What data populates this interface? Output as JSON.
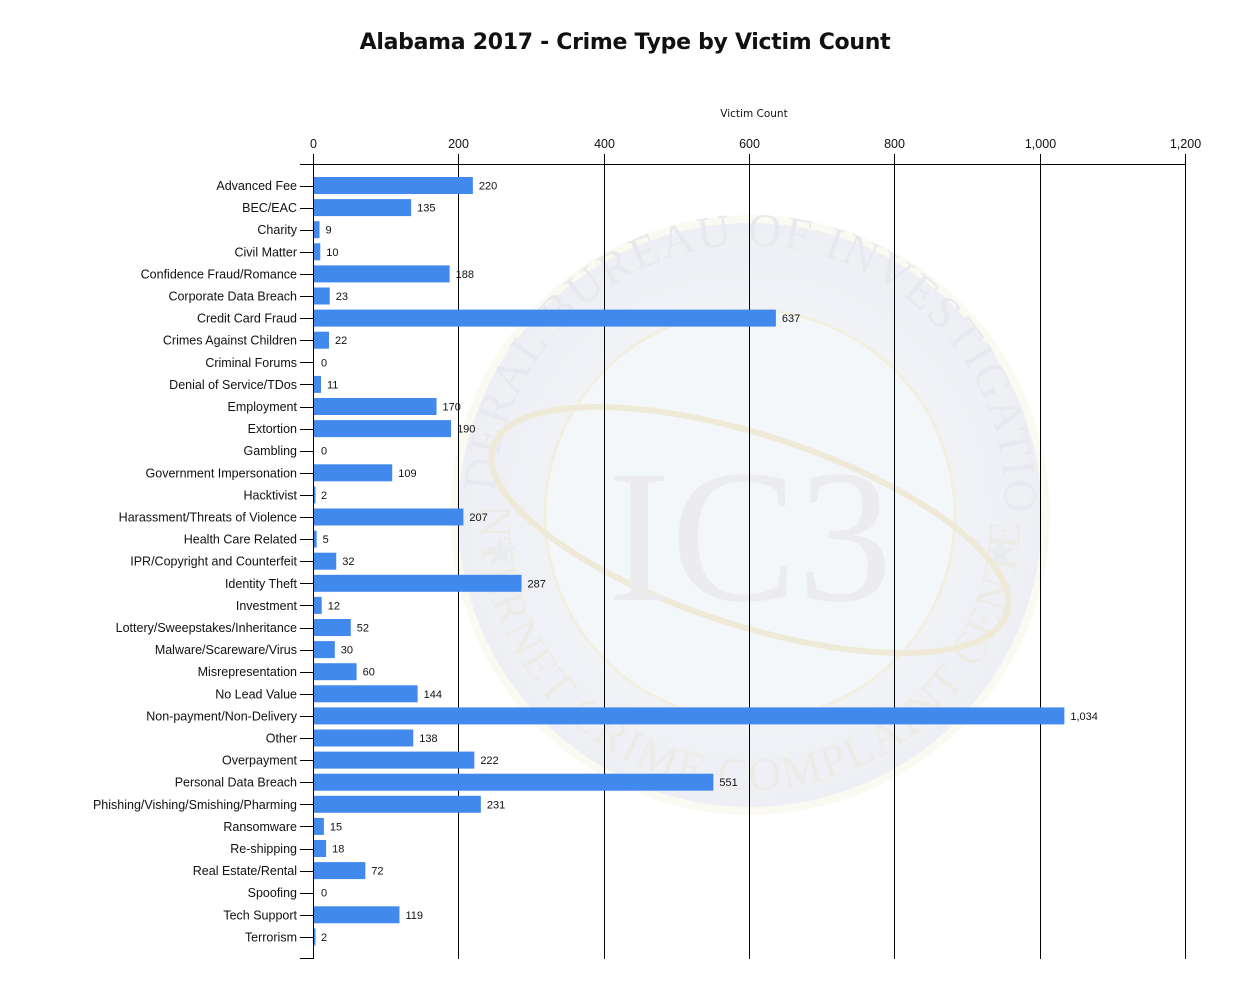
{
  "chart_data": {
    "type": "bar",
    "orientation": "horizontal",
    "title": "Alabama 2017 - Crime Type by Victim Count",
    "xlabel": "Victim Count",
    "ylabel": "",
    "xlim": [
      0,
      1200
    ],
    "x_ticks": [
      0,
      200,
      400,
      600,
      800,
      1000,
      1200
    ],
    "x_tick_labels": [
      "0",
      "200",
      "400",
      "600",
      "800",
      "1,000",
      "1,200"
    ],
    "x_axis_position": "top",
    "grid": "vertical",
    "legend": "none",
    "bar_color": "#4189EC",
    "watermark": "FEDERAL BUREAU OF INVESTIGATION - INTERNET CRIME COMPLAINT CENTER (IC3) seal",
    "categories": [
      "Advanced Fee",
      "BEC/EAC",
      "Charity",
      "Civil Matter",
      "Confidence Fraud/Romance",
      "Corporate Data Breach",
      "Credit Card Fraud",
      "Crimes Against Children",
      "Criminal Forums",
      "Denial of Service/TDos",
      "Employment",
      "Extortion",
      "Gambling",
      "Government Impersonation",
      "Hacktivist",
      "Harassment/Threats of Violence",
      "Health Care Related",
      "IPR/Copyright and Counterfeit",
      "Identity Theft",
      "Investment",
      "Lottery/Sweepstakes/Inheritance",
      "Malware/Scareware/Virus",
      "Misrepresentation",
      "No Lead Value",
      "Non-payment/Non-Delivery",
      "Other",
      "Overpayment",
      "Personal Data Breach",
      "Phishing/Vishing/Smishing/Pharming",
      "Ransomware",
      "Re-shipping",
      "Real Estate/Rental",
      "Spoofing",
      "Tech Support",
      "Terrorism"
    ],
    "values": [
      220,
      135,
      9,
      10,
      188,
      23,
      637,
      22,
      0,
      11,
      170,
      190,
      0,
      109,
      2,
      207,
      5,
      32,
      287,
      12,
      52,
      30,
      60,
      144,
      1034,
      138,
      222,
      551,
      231,
      15,
      18,
      72,
      0,
      119,
      2
    ],
    "value_labels": [
      "220",
      "135",
      "9",
      "10",
      "188",
      "23",
      "637",
      "22",
      "0",
      "11",
      "170",
      "190",
      "0",
      "109",
      "2",
      "207",
      "5",
      "32",
      "287",
      "12",
      "52",
      "30",
      "60",
      "144",
      "1,034",
      "138",
      "222",
      "551",
      "231",
      "15",
      "18",
      "72",
      "0",
      "119",
      "2"
    ]
  },
  "watermark": {
    "top_text": "FEDERAL BUREAU OF INVESTIGATION",
    "bottom_text": "INTERNET CRIME COMPLAINT CENTER",
    "center_text": "IC3"
  }
}
